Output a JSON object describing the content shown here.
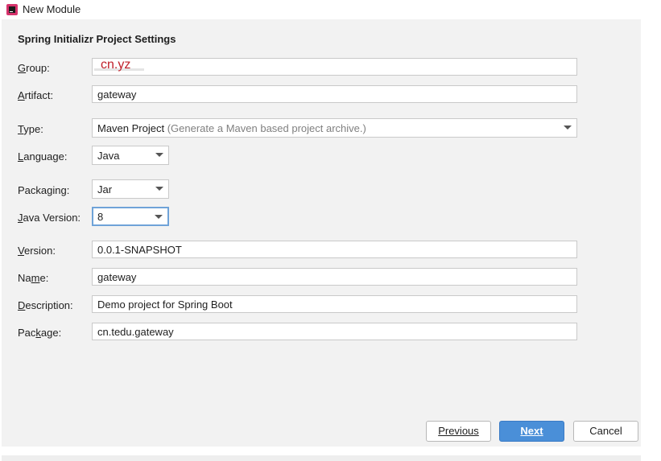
{
  "window": {
    "title": "New Module"
  },
  "section_title": "Spring Initializr Project Settings",
  "fields": {
    "group": {
      "label": "Group:",
      "value": "cn.yz"
    },
    "artifact": {
      "label": "Artifact:",
      "value": "gateway"
    },
    "type": {
      "label": "Type:",
      "value": "Maven Project",
      "hint": "(Generate a Maven based project archive.)"
    },
    "language": {
      "label": "Language:",
      "value": "Java"
    },
    "packaging": {
      "label": "Packaging:",
      "value": "Jar"
    },
    "java_version": {
      "label": "Java Version:",
      "value": "8"
    },
    "version": {
      "label": "Version:",
      "value": "0.0.1-SNAPSHOT"
    },
    "name": {
      "label": "Name:",
      "value": "gateway"
    },
    "description": {
      "label": "Description:",
      "value": "Demo project for Spring Boot"
    },
    "package": {
      "label": "Package:",
      "value": "cn.tedu.gateway"
    }
  },
  "buttons": {
    "previous": "Previous",
    "next": "Next",
    "cancel": "Cancel"
  },
  "colors": {
    "primary_button": "#4a8fd8",
    "focus_border": "#6fa3d8",
    "dialog_bg": "#f2f2f2"
  },
  "icons": {
    "app_icon": "intellij-idea-icon",
    "dropdown": "chevron-down-icon"
  }
}
